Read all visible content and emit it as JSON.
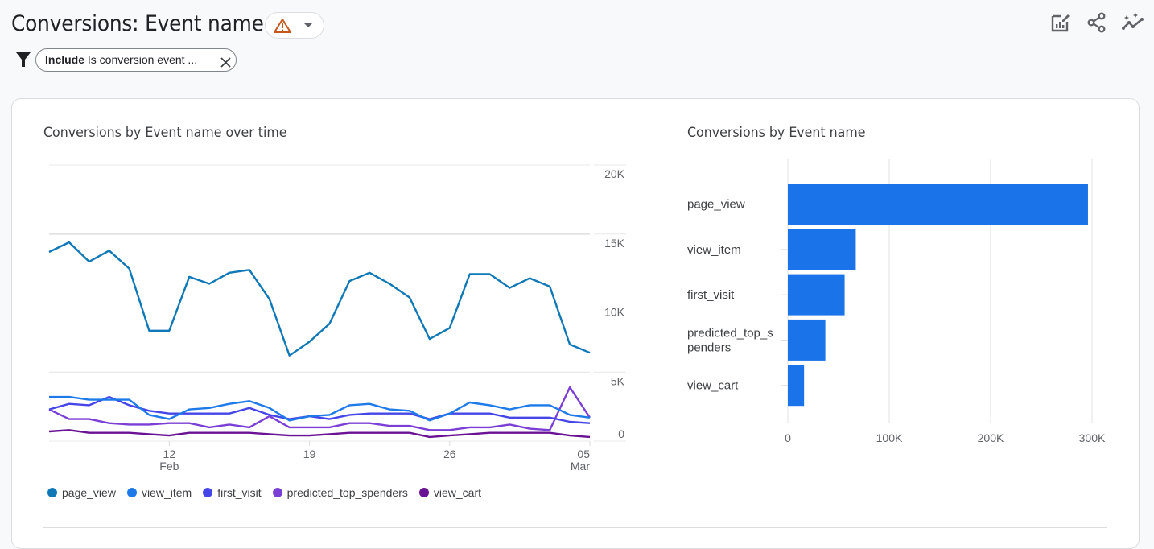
{
  "header": {
    "title": "Conversions: Event name",
    "warning_icon": "warning-triangle-icon",
    "dropdown_icon": "caret-down-icon",
    "filter": {
      "keyword": "Include",
      "text": " Is conversion event ...",
      "icon": "filter-icon",
      "remove_icon": "close-icon"
    },
    "actions": [
      {
        "name": "edit-comparison",
        "icon": "edit-chart-icon"
      },
      {
        "name": "share",
        "icon": "share-icon"
      },
      {
        "name": "insights",
        "icon": "insights-sparkle-icon"
      }
    ]
  },
  "colors": {
    "page_view": "#1078b7",
    "view_item": "#1e7ae8",
    "first_visit": "#4646e8",
    "predicted_top_spenders": "#7b3fd6",
    "view_cart": "#6a1294",
    "bar": "#1a73e8",
    "warning": "#c5581c"
  },
  "chart_data": [
    {
      "type": "line",
      "title": "Conversions by Event name over time",
      "x_tick_labels": [
        {
          "index": 6,
          "day": "12",
          "month": "Feb"
        },
        {
          "index": 13,
          "day": "19",
          "month": ""
        },
        {
          "index": 20,
          "day": "26",
          "month": ""
        },
        {
          "index": 27,
          "day": "05",
          "month": "Mar"
        }
      ],
      "y_ticks": [
        "0",
        "5K",
        "10K",
        "15K",
        "20K"
      ],
      "y_tick_values": [
        0,
        5000,
        10000,
        15000,
        20000
      ],
      "ylim": [
        0,
        20000
      ],
      "grid": true,
      "legend_position": "bottom",
      "series": [
        {
          "name": "page_view",
          "values": [
            13700,
            14400,
            13000,
            13800,
            12500,
            8000,
            8000,
            11900,
            11400,
            12200,
            12400,
            10300,
            6200,
            7200,
            8500,
            11600,
            12200,
            11400,
            10400,
            7400,
            8200,
            12100,
            12100,
            11100,
            11800,
            11200,
            7000,
            6400
          ]
        },
        {
          "name": "view_item",
          "values": [
            3200,
            3200,
            3000,
            3000,
            3000,
            1900,
            1600,
            2300,
            2400,
            2700,
            2900,
            2400,
            1500,
            1800,
            1900,
            2600,
            2700,
            2300,
            2200,
            1500,
            2000,
            2800,
            2600,
            2300,
            2600,
            2600,
            1900,
            1700
          ]
        },
        {
          "name": "first_visit",
          "values": [
            2300,
            2700,
            2600,
            3200,
            2600,
            2200,
            2000,
            2000,
            2000,
            2000,
            2400,
            1900,
            1600,
            1800,
            1600,
            1900,
            2000,
            2000,
            2000,
            1600,
            2000,
            2000,
            2000,
            1700,
            1700,
            1700,
            1400,
            1300
          ]
        },
        {
          "name": "predicted_top_spenders",
          "values": [
            2300,
            1600,
            1600,
            1300,
            1200,
            1200,
            1300,
            1300,
            1000,
            1200,
            1000,
            1800,
            1000,
            1000,
            1000,
            1300,
            1300,
            1100,
            1100,
            800,
            800,
            1000,
            1000,
            1200,
            900,
            800,
            3900,
            1700
          ]
        },
        {
          "name": "view_cart",
          "values": [
            700,
            800,
            600,
            600,
            600,
            500,
            400,
            600,
            600,
            600,
            600,
            500,
            400,
            400,
            500,
            600,
            600,
            600,
            600,
            300,
            400,
            500,
            600,
            600,
            600,
            600,
            400,
            300
          ]
        }
      ]
    },
    {
      "type": "bar",
      "orientation": "horizontal",
      "title": "Conversions by Event name",
      "categories": [
        "page_view",
        "view_item",
        "first_visit",
        "predicted_top_spenders",
        "view_cart"
      ],
      "category_display": [
        [
          "page_view"
        ],
        [
          "view_item"
        ],
        [
          "first_visit"
        ],
        [
          "predicted_top_s",
          "penders"
        ],
        [
          "view_cart"
        ]
      ],
      "values": [
        296000,
        67000,
        56000,
        37000,
        16000
      ],
      "x_ticks": [
        "0",
        "100K",
        "200K",
        "300K"
      ],
      "x_tick_values": [
        0,
        100000,
        200000,
        300000
      ],
      "xlim": [
        0,
        300000
      ],
      "grid": true
    }
  ]
}
